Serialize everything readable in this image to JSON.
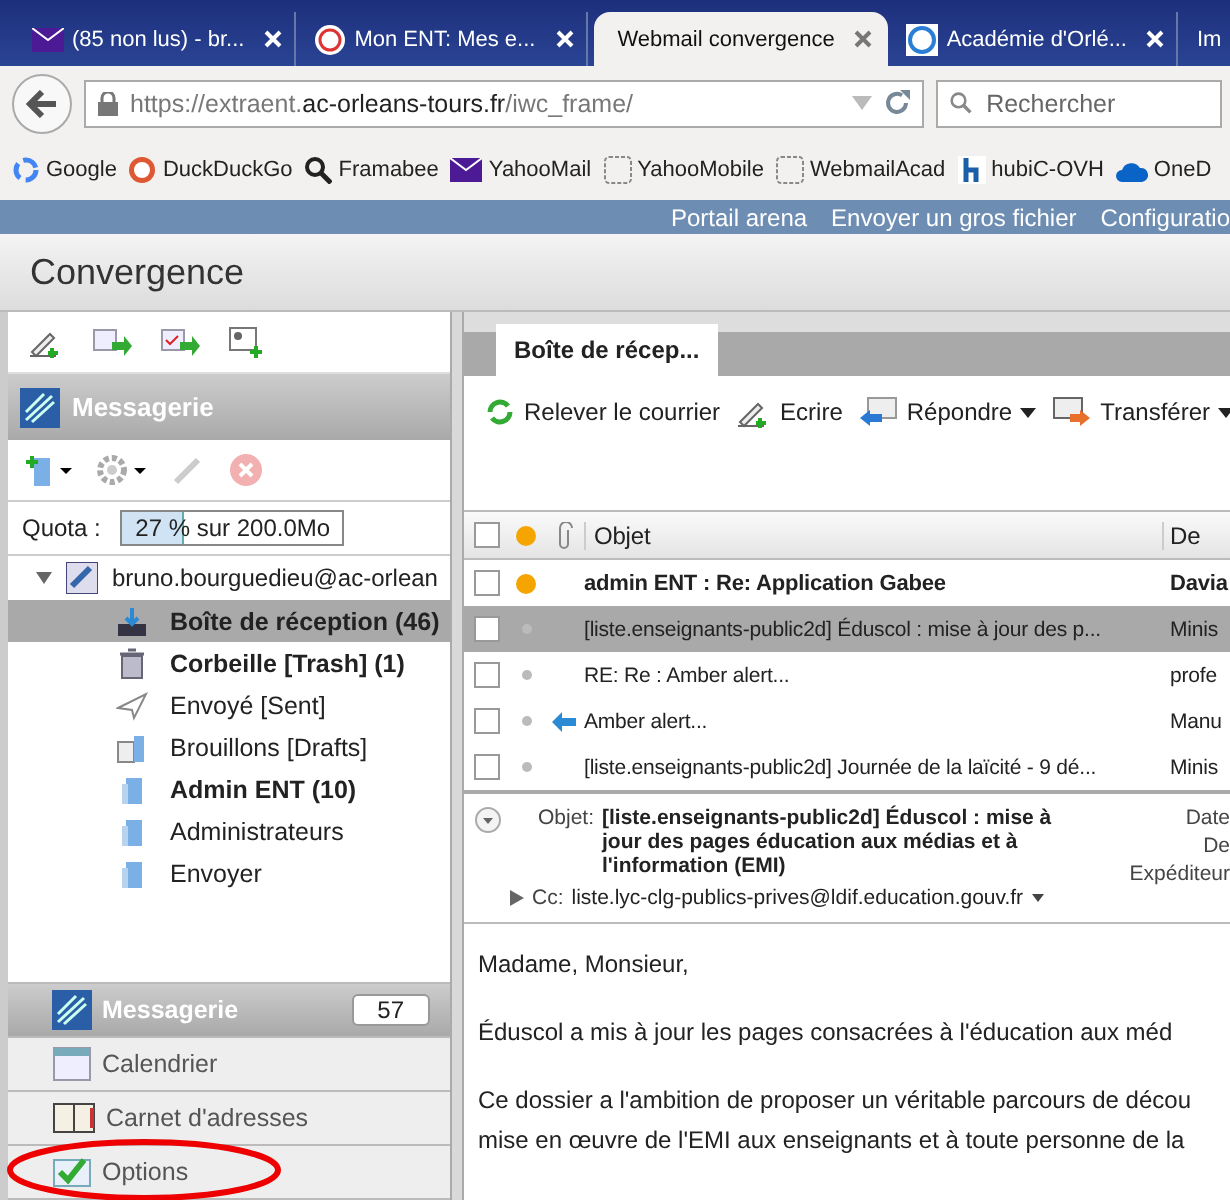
{
  "browser": {
    "tabs": [
      {
        "title": "(85 non lus) - br...",
        "kind": "mail",
        "selected": false
      },
      {
        "title": "Mon ENT: Mes e...",
        "kind": "ent",
        "selected": false
      },
      {
        "title": "Webmail convergence",
        "kind": "plain",
        "selected": true
      },
      {
        "title": "Académie d'Orlé...",
        "kind": "academie",
        "selected": false
      },
      {
        "title": "Im",
        "kind": "partial",
        "selected": false
      }
    ],
    "url": {
      "scheme": "https://",
      "subdomain": "extraent.",
      "domain": "ac-orleans-tours.fr",
      "path": "/iwc_frame/"
    },
    "search": {
      "placeholder": "Rechercher"
    },
    "bookmarks": [
      {
        "label": "Google",
        "kind": "google"
      },
      {
        "label": "DuckDuckGo",
        "kind": "duck"
      },
      {
        "label": "Framabee",
        "kind": "magnifier"
      },
      {
        "label": "YahooMail",
        "kind": "mail"
      },
      {
        "label": "YahooMobile",
        "kind": "blank"
      },
      {
        "label": "WebmailAcad",
        "kind": "blank"
      },
      {
        "label": "hubiC-OVH",
        "kind": "hubic"
      },
      {
        "label": "OneD",
        "kind": "cloud"
      }
    ]
  },
  "top_links": [
    "Portail arena",
    "Envoyer un gros fichier",
    "Configuratio"
  ],
  "app_title": "Convergence",
  "sidebar": {
    "section_title": "Messagerie",
    "quota": {
      "label": "Quota :",
      "text": "27 % sur 200.0Mo",
      "level": 0.27
    },
    "account": {
      "name": "bruno.bourguedieu@ac-orlean",
      "expanded": true
    },
    "folders": [
      {
        "label": "Boîte de réception (46)",
        "kind": "inbox",
        "bold": true,
        "selected": true
      },
      {
        "label": "Corbeille [Trash] (1)",
        "kind": "trash",
        "bold": true,
        "selected": false
      },
      {
        "label": "Envoyé [Sent]",
        "kind": "sent",
        "bold": false,
        "selected": false
      },
      {
        "label": "Brouillons [Drafts]",
        "kind": "drafts",
        "bold": false,
        "selected": false
      },
      {
        "label": "Admin ENT (10)",
        "kind": "folder",
        "bold": true,
        "selected": false
      },
      {
        "label": "Administrateurs",
        "kind": "folder",
        "bold": false,
        "selected": false
      },
      {
        "label": "Envoyer",
        "kind": "folder",
        "bold": false,
        "selected": false
      }
    ],
    "modules": [
      {
        "label": "Messagerie",
        "kind": "mail",
        "selected": true,
        "badge": "57",
        "highlighted": false
      },
      {
        "label": "Calendrier",
        "kind": "calendar",
        "selected": false,
        "highlighted": false
      },
      {
        "label": "Carnet d'adresses",
        "kind": "book",
        "selected": false,
        "highlighted": false
      },
      {
        "label": "Options",
        "kind": "options",
        "selected": false,
        "highlighted": true
      }
    ]
  },
  "mail": {
    "tab": "Boîte de récep...",
    "toolbar": [
      {
        "label": "Relever le courrier",
        "kind": "refresh",
        "dropdown": false
      },
      {
        "label": "Ecrire",
        "kind": "compose",
        "dropdown": false
      },
      {
        "label": "Répondre",
        "kind": "reply",
        "dropdown": true
      },
      {
        "label": "Transférer",
        "kind": "forward",
        "dropdown": true
      }
    ],
    "all_checked": false,
    "columns": {
      "subject": "Objet",
      "from": "De"
    },
    "rows": [
      {
        "subject": "admin ENT : Re: Application Gabee",
        "from": "Davia",
        "checked": false,
        "unread": true,
        "flagged": true,
        "replied": false,
        "selected": false
      },
      {
        "subject": "[liste.enseignants-public2d] Éduscol : mise à jour des p...",
        "from": "Minis",
        "checked": false,
        "unread": false,
        "flagged": false,
        "replied": false,
        "selected": true
      },
      {
        "subject": "RE: Re : Amber alert...",
        "from": "profe",
        "checked": false,
        "unread": false,
        "flagged": false,
        "replied": false,
        "selected": false
      },
      {
        "subject": "Amber alert...",
        "from": "Manu",
        "checked": false,
        "unread": false,
        "flagged": false,
        "replied": true,
        "selected": false
      },
      {
        "subject": "[liste.enseignants-public2d] Journée de la laïcité - 9 dé...",
        "from": "Minis",
        "checked": false,
        "unread": false,
        "flagged": false,
        "replied": false,
        "selected": false
      }
    ]
  },
  "preview": {
    "subject_label": "Objet:",
    "subject": "[liste.enseignants-public2d] Éduscol : mise à jour des pages éducation aux médias et à l'information (EMI)",
    "cc_label": "Cc:",
    "cc": "liste.lyc-clg-publics-prives@ldif.education.gouv.fr",
    "side_labels": [
      "Date",
      "De",
      "Expéditeur"
    ],
    "body": [
      [
        "Madame, Monsieur,"
      ],
      [
        "Éduscol a mis à jour les pages consacrées à l'éducation aux méd"
      ],
      [
        "Ce dossier a l'ambition de proposer un véritable parcours de décou",
        "mise en œuvre de l'EMI aux enseignants et à toute personne de la"
      ]
    ]
  }
}
